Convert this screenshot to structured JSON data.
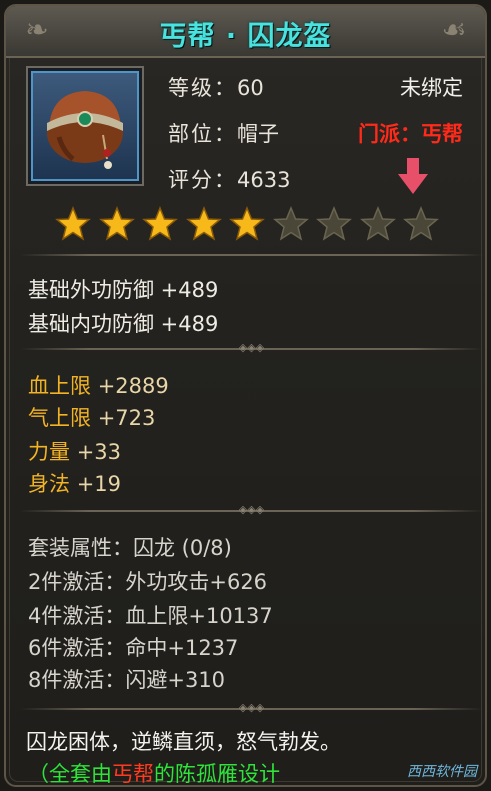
{
  "item": {
    "name": "丐帮 · 囚龙盔",
    "level_label": "等级：",
    "level": "60",
    "slot_label": "部位：",
    "slot": "帽子",
    "score_label": "评分：",
    "score": "4633",
    "bind_status": "未绑定",
    "sect_requirement": "门派：丐帮",
    "stars_filled": 5,
    "stars_total": 9
  },
  "base_stats": [
    {
      "text": "基础外功防御 +489"
    },
    {
      "text": "基础内功防御 +489"
    }
  ],
  "bonus_stats": [
    {
      "name": "血上限",
      "value": "+2889"
    },
    {
      "name": "气上限",
      "value": "+723"
    },
    {
      "name": "力量",
      "value": "+33"
    },
    {
      "name": "身法",
      "value": "+19"
    }
  ],
  "set": {
    "header": "套装属性：囚龙 (0/8)",
    "bonuses": [
      {
        "text": "2件激活：外功攻击+626"
      },
      {
        "text": "4件激活：血上限+10137"
      },
      {
        "text": "6件激活：命中+1237"
      },
      {
        "text": "8件激活：闪避+310"
      }
    ]
  },
  "flavor_text": "囚龙困体，逆鳞直须，怒气勃发。",
  "credit": {
    "prefix": "（全套由",
    "sect": "丐帮",
    "suffix": "的陈孤雁设计"
  },
  "watermark": "西西软件园",
  "colors": {
    "title": "#49e3df",
    "sect": "#ff2a1a",
    "bonus_name": "#f2b424",
    "credit": "#2ee33a",
    "star_filled": "#f7b81a",
    "star_empty": "#4a4738"
  },
  "icons": [
    "helmet-icon",
    "down-arrow-icon",
    "star-icon"
  ]
}
